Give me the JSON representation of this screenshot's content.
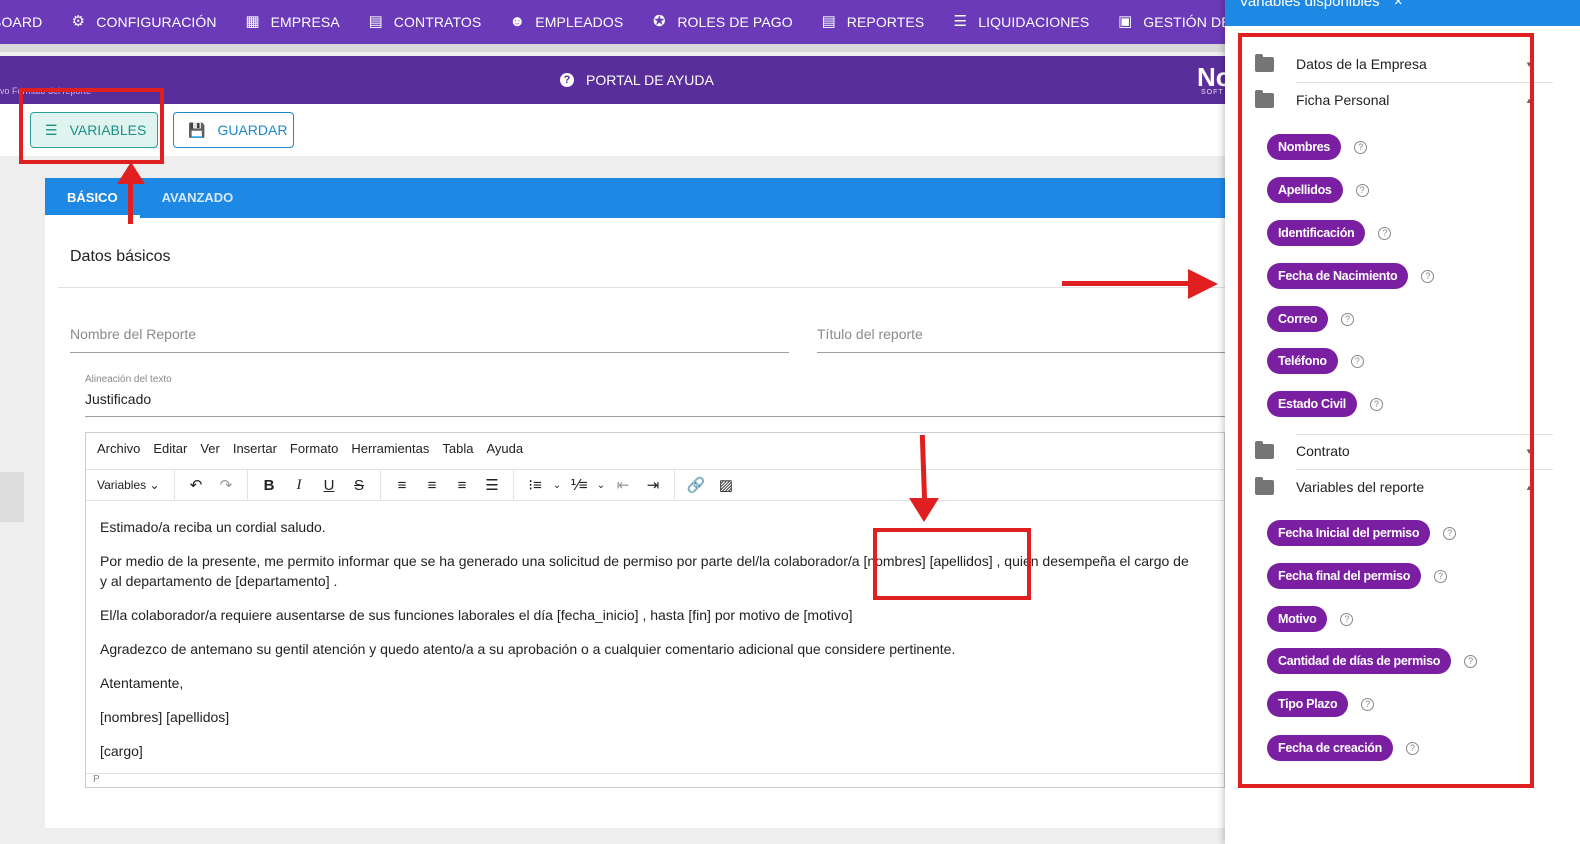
{
  "topnav": {
    "items": [
      {
        "label": "BOARD",
        "icon": "dashboard-icon"
      },
      {
        "label": "CONFIGURACIÓN",
        "icon": "gear-icon"
      },
      {
        "label": "EMPRESA",
        "icon": "building-icon"
      },
      {
        "label": "CONTRATOS",
        "icon": "clipboard-icon"
      },
      {
        "label": "EMPLEADOS",
        "icon": "face-icon"
      },
      {
        "label": "ROLES DE PAGO",
        "icon": "users-icon"
      },
      {
        "label": "REPORTES",
        "icon": "clipboard-icon"
      },
      {
        "label": "LIQUIDACIONES",
        "icon": "list-icon"
      },
      {
        "label": "GESTIÓN DE TURNOS",
        "icon": "calendar-icon"
      }
    ]
  },
  "subheader": {
    "breadcrumb": "vo Formato del reporte",
    "help_label": "PORTAL DE AYUDA",
    "logo_text": "No",
    "logo_sub": "SOFT"
  },
  "actions": {
    "variables_label": "VARIABLES",
    "guardar_label": "GUARDAR"
  },
  "tabs": [
    {
      "label": "BÁSICO",
      "active": true
    },
    {
      "label": "AVANZADO",
      "active": false
    }
  ],
  "form": {
    "section_title": "Datos básicos",
    "nombre_placeholder": "Nombre del Reporte",
    "titulo_placeholder": "Título del reporte",
    "align_label": "Alineación del texto",
    "align_value": "Justificado"
  },
  "editor": {
    "menu": [
      "Archivo",
      "Editar",
      "Ver",
      "Insertar",
      "Formato",
      "Herramientas",
      "Tabla",
      "Ayuda"
    ],
    "variables_dropdown": "Variables",
    "paragraphs": [
      "Estimado/a reciba un cordial saludo.",
      "Por medio de la presente, me permito informar que se ha generado una solicitud de permiso por parte del/la colaborador/a [nombres]   [apellidos]  , quien desempeña el cargo de",
      "y al departamento de [departamento] .",
      "El/la colaborador/a requiere ausentarse de sus funciones laborales el día   [fecha_inicio] , hasta  [fin] por motivo de   [motivo]",
      "Agradezco de antemano su gentil atención y quedo atento/a a su aprobación o a cualquier comentario adicional que considere pertinente.",
      "Atentamente,",
      "[nombres]   [apellidos]",
      "[cargo]"
    ],
    "status": "P"
  },
  "panel": {
    "title": "Variables disponibles",
    "close": "×",
    "groups": [
      {
        "label": "Datos de la Empresa",
        "expanded": false
      },
      {
        "label": "Ficha Personal",
        "expanded": true
      },
      {
        "label": "Contrato",
        "expanded": false
      },
      {
        "label": "Variables del reporte",
        "expanded": true
      }
    ],
    "ficha_chips": [
      "Nombres",
      "Apellidos",
      "Identificación",
      "Fecha de Nacimiento",
      "Correo",
      "Teléfono",
      "Estado Civil"
    ],
    "reporte_chips": [
      "Fecha Inicial del permiso",
      "Fecha final del permiso",
      "Motivo",
      "Cantidad de días de permiso",
      "Tipo Plazo",
      "Fecha de creación"
    ],
    "help_glyph": "?"
  },
  "colors": {
    "nav": "#6a3ab8",
    "subheader": "#5a2e9a",
    "tab_bar": "#1e88e5",
    "chip": "#7b1fa2",
    "annotation": "#e02020"
  }
}
